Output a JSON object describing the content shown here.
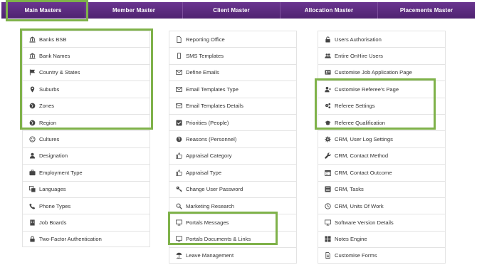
{
  "tabs": [
    "Main Masters",
    "Member Master",
    "Client Master",
    "Allocation Master",
    "Placements Master"
  ],
  "columns": [
    [
      {
        "label": "Banks BSB",
        "icon": "bank-icon"
      },
      {
        "label": "Bank Names",
        "icon": "bank-icon"
      },
      {
        "label": "Country & States",
        "icon": "flag-icon"
      },
      {
        "label": "Suburbs",
        "icon": "map-marker-icon"
      },
      {
        "label": "Zones",
        "icon": "globe-icon"
      },
      {
        "label": "Region",
        "icon": "globe-icon"
      },
      {
        "label": "Cultures",
        "icon": "smile-icon"
      },
      {
        "label": "Designation",
        "icon": "user-icon"
      },
      {
        "label": "Employment Type",
        "icon": "briefcase-icon"
      },
      {
        "label": "Languages",
        "icon": "language-icon"
      },
      {
        "label": "Phone Types",
        "icon": "phone-icon"
      },
      {
        "label": "Job Boards",
        "icon": "building-icon"
      },
      {
        "label": "Two-Factor Authentication",
        "icon": "lock-icon"
      }
    ],
    [
      {
        "label": "Reporting Office",
        "icon": "file-icon"
      },
      {
        "label": "SMS Templates",
        "icon": "mobile-icon"
      },
      {
        "label": "Define Emails",
        "icon": "envelope-icon"
      },
      {
        "label": "Email Templates Type",
        "icon": "envelope-icon"
      },
      {
        "label": "Email Templates Details",
        "icon": "envelope-icon"
      },
      {
        "label": "Priorities (People)",
        "icon": "check-square-icon"
      },
      {
        "label": "Reasons (Personnel)",
        "icon": "question-icon"
      },
      {
        "label": "Appraisal Category",
        "icon": "thumbs-up-icon"
      },
      {
        "label": "Appraisal Type",
        "icon": "thumbs-up-icon"
      },
      {
        "label": "Change User Password",
        "icon": "key-icon"
      },
      {
        "label": "Marketing Research",
        "icon": "search-icon"
      },
      {
        "label": "Portals Messages",
        "icon": "monitor-icon"
      },
      {
        "label": "Portals Documents & Links",
        "icon": "monitor-icon"
      },
      {
        "label": "Leave Management",
        "icon": "leave-icon"
      }
    ],
    [
      {
        "label": "Users Authorisation",
        "icon": "unlock-icon"
      },
      {
        "label": "Entire OnHire Users",
        "icon": "users-icon"
      },
      {
        "label": "Customise Job Application Page",
        "icon": "id-card-icon"
      },
      {
        "label": "Customise Referee's Page",
        "icon": "user-plus-icon"
      },
      {
        "label": "Referee Settings",
        "icon": "cogs-icon"
      },
      {
        "label": "Referee Qualification",
        "icon": "graduation-cap-icon"
      },
      {
        "label": "CRM, User Log Settings",
        "icon": "gear-icon"
      },
      {
        "label": "CRM, Contact Method",
        "icon": "wrench-icon"
      },
      {
        "label": "CRM, Contact Outcome",
        "icon": "calendar-icon"
      },
      {
        "label": "CRM, Tasks",
        "icon": "tasks-icon"
      },
      {
        "label": "CRM, Units Of Work",
        "icon": "clock-icon"
      },
      {
        "label": "Software Version Details",
        "icon": "monitor-icon"
      },
      {
        "label": "Notes Engine",
        "icon": "grid-icon"
      },
      {
        "label": "Customise Forms",
        "icon": "file-text-icon"
      }
    ]
  ],
  "colors": {
    "tab_bg": "#5a2a7c",
    "highlight": "#7fb24a"
  }
}
